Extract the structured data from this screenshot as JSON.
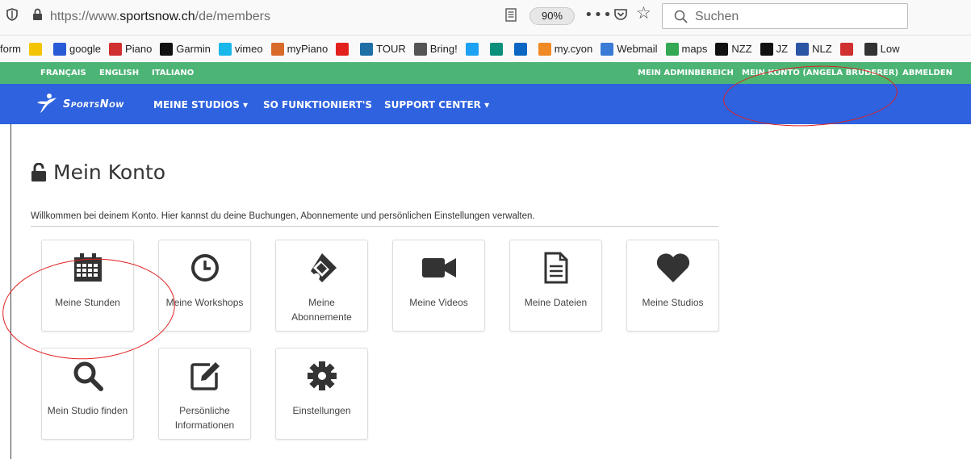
{
  "browser": {
    "url_prefix": "https://www.",
    "url_domain": "sportsnow.ch",
    "url_path": "/de/members",
    "zoom": "90%",
    "search_placeholder": "Suchen"
  },
  "bookmarks": [
    {
      "label": "form",
      "icon": "none",
      "color": ""
    },
    {
      "label": "",
      "icon": "c-icon",
      "color": "#f5c400"
    },
    {
      "label": "google",
      "icon": "google-icon",
      "color": "#2a5bd7"
    },
    {
      "label": "Piano",
      "icon": "piano-icon",
      "color": "#d0302f"
    },
    {
      "label": "Garmin",
      "icon": "garmin-icon",
      "color": "#111111"
    },
    {
      "label": "vimeo",
      "icon": "vimeo-icon",
      "color": "#1ab7ea"
    },
    {
      "label": "myPiano",
      "icon": "mypiano-icon",
      "color": "#d86a2a"
    },
    {
      "label": "",
      "icon": "swiss-icon",
      "color": "#e3211c"
    },
    {
      "label": "TOUR",
      "icon": "tour-icon",
      "color": "#1d6fa6"
    },
    {
      "label": "Bring!",
      "icon": "globe-icon",
      "color": "#555555"
    },
    {
      "label": "",
      "icon": "twitter-icon",
      "color": "#1da1f2"
    },
    {
      "label": "",
      "icon": "xing-icon",
      "color": "#0a8f7a"
    },
    {
      "label": "",
      "icon": "linkedin-icon",
      "color": "#0a66c2"
    },
    {
      "label": "my.cyon",
      "icon": "cyon-icon",
      "color": "#f08a24"
    },
    {
      "label": "Webmail",
      "icon": "webmail-icon",
      "color": "#3a7bd5"
    },
    {
      "label": "maps",
      "icon": "maps-icon",
      "color": "#34a853"
    },
    {
      "label": "NZZ",
      "icon": "nzz-icon",
      "color": "#111111"
    },
    {
      "label": "JZ",
      "icon": "jz-icon",
      "color": "#111111"
    },
    {
      "label": "NLZ",
      "icon": "nlz-icon",
      "color": "#2a55a5"
    },
    {
      "label": "",
      "icon": "r-icon",
      "color": "#d0302f"
    },
    {
      "label": "Low",
      "icon": "folder-icon",
      "color": "#333333"
    }
  ],
  "site": {
    "languages": [
      "FRANÇAIS",
      "ENGLISH",
      "ITALIANO"
    ],
    "account_links": [
      "MEIN ADMINBEREICH",
      "MEIN KONTO (ANGELA BRUDERER)",
      "ABMELDEN"
    ],
    "logo_text": "SportsNow",
    "nav": [
      "MEINE STUDIOS ▾",
      "SO FUNKTIONIERT'S",
      "SUPPORT CENTER ▾"
    ],
    "brand_green": "#4cb575",
    "brand_blue": "#2e62df"
  },
  "page": {
    "title": "Mein Konto",
    "welcome": "Willkommen bei deinem Konto. Hier kannst du deine Buchungen, Abonnemente und persönlichen Einstellungen verwalten."
  },
  "tiles": [
    {
      "label": "Meine Stunden",
      "icon": "calendar-icon"
    },
    {
      "label": "Meine Workshops",
      "icon": "clock-icon"
    },
    {
      "label": "Meine Abonnemente",
      "icon": "ticket-icon"
    },
    {
      "label": "Meine Videos",
      "icon": "video-camera-icon"
    },
    {
      "label": "Meine Dateien",
      "icon": "file-icon"
    },
    {
      "label": "Meine Studios",
      "icon": "heart-icon"
    },
    {
      "label": "Mein Studio finden",
      "icon": "magnifier-icon"
    },
    {
      "label": "Persönliche Informationen",
      "icon": "edit-icon"
    },
    {
      "label": "Einstellungen",
      "icon": "gear-icon"
    }
  ],
  "annotation_color": "#e02020"
}
